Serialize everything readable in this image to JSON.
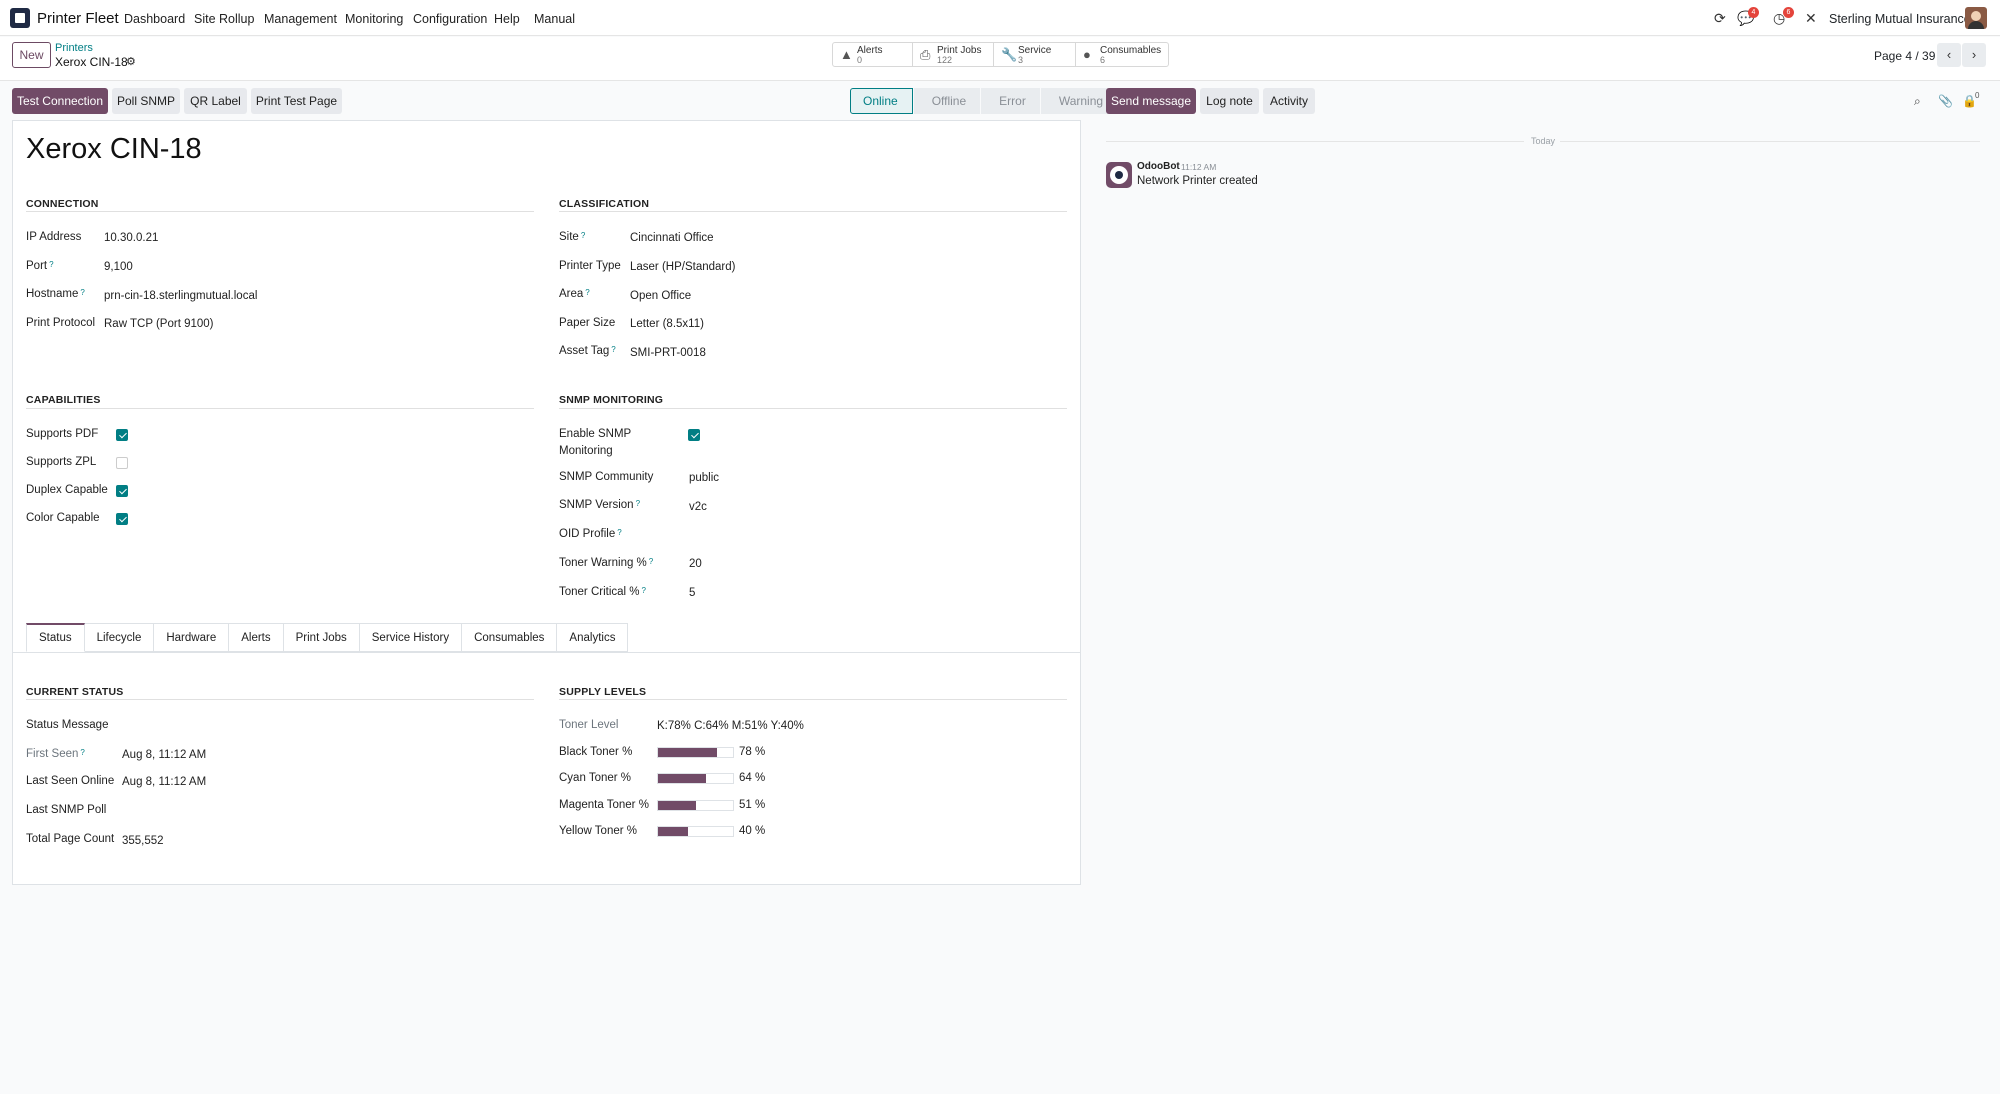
{
  "nav": {
    "brand": "Printer Fleet",
    "menu": [
      "Dashboard",
      "Site Rollup",
      "Management",
      "Monitoring",
      "Configuration",
      "Help",
      "Manual"
    ],
    "messages_badge": "4",
    "activities_badge": "6",
    "company": "Sterling Mutual Insurance"
  },
  "control": {
    "new_label": "New",
    "breadcrumb_parent": "Printers",
    "breadcrumb_current": "Xerox CIN-18",
    "stats": [
      {
        "label": "Alerts",
        "value": "0",
        "icon": "warning-icon"
      },
      {
        "label": "Print Jobs",
        "value": "122",
        "icon": "printer-icon"
      },
      {
        "label": "Service",
        "value": "3",
        "icon": "wrench-icon"
      },
      {
        "label": "Consumables",
        "value": "6",
        "icon": "drop-icon"
      }
    ],
    "pager": "Page 4 / 39"
  },
  "actions": {
    "test_connection": "Test Connection",
    "poll_snmp": "Poll SNMP",
    "qr_label": "QR Label",
    "print_test_page": "Print Test Page"
  },
  "statusbar": [
    "Online",
    "Offline",
    "Error",
    "Warning"
  ],
  "form": {
    "title": "Xerox CIN-18",
    "connection": {
      "heading": "CONNECTION",
      "ip_label": "IP Address",
      "ip": "10.30.0.21",
      "port_label": "Port",
      "port": "9,100",
      "hostname_label": "Hostname",
      "hostname": "prn-cin-18.sterlingmutual.local",
      "protocol_label": "Print Protocol",
      "protocol": "Raw TCP (Port 9100)"
    },
    "classification": {
      "heading": "CLASSIFICATION",
      "site_label": "Site",
      "site": "Cincinnati Office",
      "type_label": "Printer Type",
      "type": "Laser (HP/Standard)",
      "area_label": "Area",
      "area": "Open Office",
      "paper_label": "Paper Size",
      "paper": "Letter (8.5x11)",
      "asset_label": "Asset Tag",
      "asset": "SMI-PRT-0018"
    },
    "capabilities": {
      "heading": "CAPABILITIES",
      "pdf_label": "Supports PDF",
      "pdf": true,
      "zpl_label": "Supports ZPL",
      "zpl": false,
      "duplex_label": "Duplex Capable",
      "duplex": true,
      "color_label": "Color Capable",
      "color": true
    },
    "snmp": {
      "heading": "SNMP MONITORING",
      "enable_label_1": "Enable SNMP",
      "enable_label_2": "Monitoring",
      "enable": true,
      "community_label": "SNMP Community",
      "community": "public",
      "version_label": "SNMP Version",
      "version": "v2c",
      "oid_label": "OID Profile",
      "warning_label": "Toner Warning %",
      "warning": "20",
      "critical_label": "Toner Critical %",
      "critical": "5"
    },
    "tabs": [
      "Status",
      "Lifecycle",
      "Hardware",
      "Alerts",
      "Print Jobs",
      "Service History",
      "Consumables",
      "Analytics"
    ],
    "current_status": {
      "heading": "CURRENT STATUS",
      "message_label": "Status Message",
      "first_seen_label": "First Seen",
      "first_seen": "Aug 8, 11:12 AM",
      "last_online_label": "Last Seen Online",
      "last_online": "Aug 8, 11:12 AM",
      "last_poll_label": "Last SNMP Poll",
      "page_count_label": "Total Page Count",
      "page_count": "355,552"
    },
    "supply": {
      "heading": "SUPPLY LEVELS",
      "toner_level_label": "Toner Level",
      "toner_level": "K:78% C:64% M:51% Y:40%",
      "levels": [
        {
          "label": "Black Toner %",
          "value": 78,
          "text": "78 %"
        },
        {
          "label": "Cyan Toner %",
          "value": 64,
          "text": "64 %"
        },
        {
          "label": "Magenta Toner %",
          "value": 51,
          "text": "51 %"
        },
        {
          "label": "Yellow Toner %",
          "value": 40,
          "text": "40 %"
        }
      ]
    }
  },
  "chatter": {
    "send_message": "Send message",
    "log_note": "Log note",
    "activity": "Activity",
    "followers": "0",
    "day": "Today",
    "author": "OdooBot",
    "time": "11:12 AM",
    "message": "Network Printer created"
  },
  "colors": {
    "primary": "#714b67",
    "accent": "#017e84"
  }
}
